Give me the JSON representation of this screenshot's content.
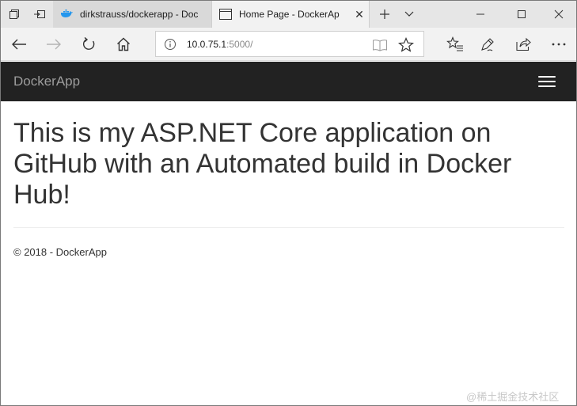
{
  "browser": {
    "tabs": [
      {
        "title": "dirkstrauss/dockerapp - Doc",
        "active": false,
        "favicon": "docker-whale-icon"
      },
      {
        "title": "Home Page - DockerAp",
        "active": true,
        "favicon": "page-icon"
      }
    ],
    "address": {
      "host": "10.0.75.1",
      "port": ":5000/"
    }
  },
  "page": {
    "brand": "DockerApp",
    "heading": "This is my ASP.NET Core application on GitHub with an Automated build in Docker Hub!",
    "footer": "© 2018 - DockerApp"
  },
  "watermark": "@稀土掘金技术社区",
  "colors": {
    "navbar_bg": "#222222",
    "brand_text": "#9d9d9d",
    "body_text": "#333333",
    "docker_blue": "#2496ed"
  }
}
